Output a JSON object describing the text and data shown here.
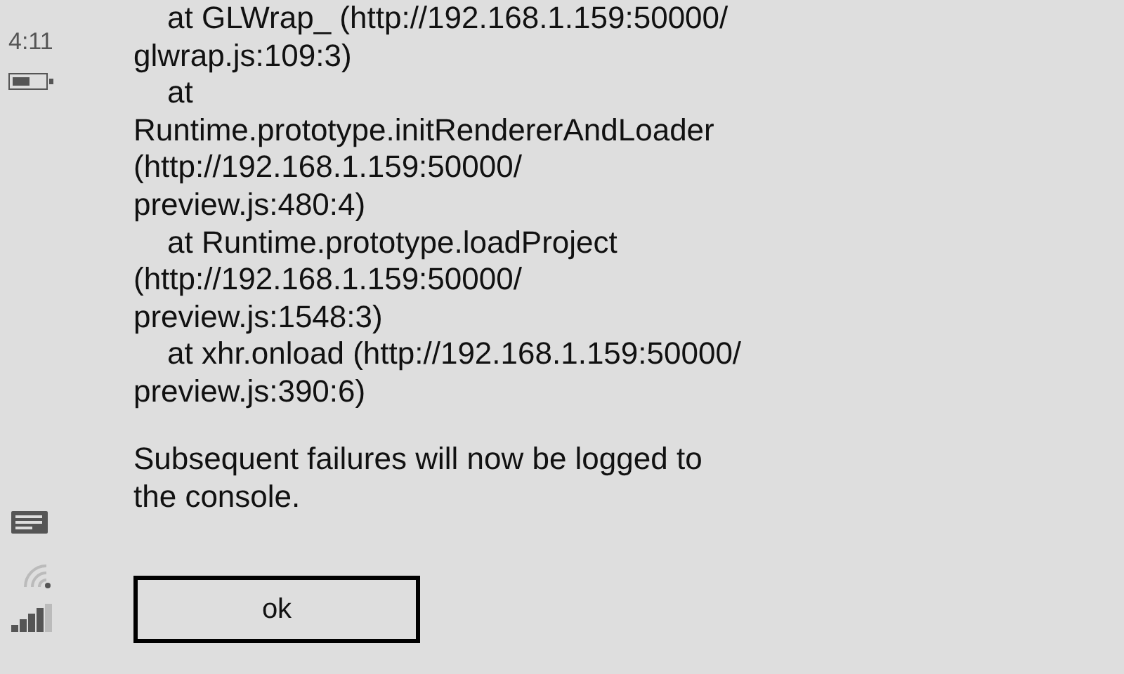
{
  "status_bar": {
    "time": "4:11"
  },
  "dialog": {
    "trace_lines": [
      {
        "text": "at GLWrap_ (http://192.168.1.159:50000/",
        "indented": true
      },
      {
        "text": "glwrap.js:109:3)",
        "indented": false
      },
      {
        "text": "at",
        "indented": true
      },
      {
        "text": "Runtime.prototype.initRendererAndLoader",
        "indented": false
      },
      {
        "text": "(http://192.168.1.159:50000/",
        "indented": false
      },
      {
        "text": "preview.js:480:4)",
        "indented": false
      },
      {
        "text": "at Runtime.prototype.loadProject",
        "indented": true
      },
      {
        "text": "(http://192.168.1.159:50000/",
        "indented": false
      },
      {
        "text": "preview.js:1548:3)",
        "indented": false
      },
      {
        "text": "at xhr.onload (http://192.168.1.159:50000/",
        "indented": true
      },
      {
        "text": "preview.js:390:6)",
        "indented": false
      }
    ],
    "note": "Subsequent failures will now be logged to the console.",
    "button": "ok"
  }
}
